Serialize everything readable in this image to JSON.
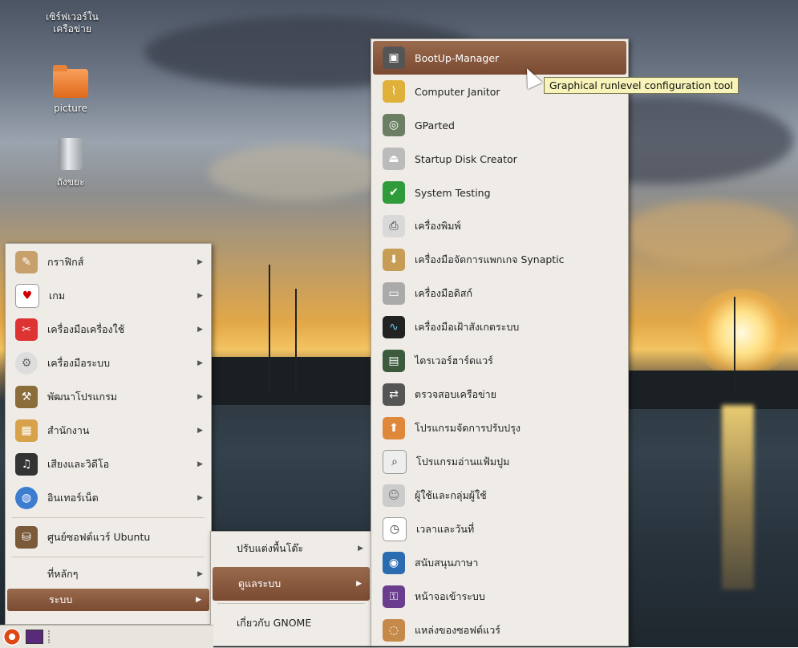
{
  "desktop": {
    "icons": [
      {
        "label": "เซิร์ฟเวอร์ใน\nเครือข่าย",
        "icon": "network-server-icon"
      },
      {
        "label": "picture",
        "icon": "folder-icon"
      },
      {
        "label": "ถังขยะ",
        "icon": "trash-icon"
      }
    ]
  },
  "main_menu": {
    "items": [
      {
        "label": "กราฟิกส์",
        "icon": "graphics-icon",
        "has_sub": true
      },
      {
        "label": "เกม",
        "icon": "games-icon",
        "has_sub": true
      },
      {
        "label": "เครื่องมือเครื่องใช้",
        "icon": "accessories-icon",
        "has_sub": true
      },
      {
        "label": "เครื่องมือระบบ",
        "icon": "system-tools-icon",
        "has_sub": true
      },
      {
        "label": "พัฒนาโปรแกรม",
        "icon": "programming-icon",
        "has_sub": true
      },
      {
        "label": "สำนักงาน",
        "icon": "office-icon",
        "has_sub": true
      },
      {
        "label": "เสียงและวิดีโอ",
        "icon": "sound-video-icon",
        "has_sub": true
      },
      {
        "label": "อินเทอร์เน็ต",
        "icon": "internet-icon",
        "has_sub": true
      },
      {
        "label": "ศูนย์ซอฟต์แวร์ Ubuntu",
        "icon": "ubuntu-software-center-icon",
        "has_sub": false
      }
    ],
    "places_label": "ที่หลักๆ",
    "system_label": "ระบบ"
  },
  "system_menu": {
    "items": [
      {
        "label": "ปรับแต่งพื้นโต๊ะ",
        "has_sub": true
      },
      {
        "label": "ดูแลระบบ",
        "has_sub": true
      },
      {
        "label": "เกี่ยวกับ GNOME",
        "has_sub": false
      }
    ]
  },
  "admin_menu": {
    "items": [
      {
        "label": "BootUp-Manager",
        "icon": "bootup-manager-icon"
      },
      {
        "label": "Computer Janitor",
        "icon": "broom-icon"
      },
      {
        "label": "GParted",
        "icon": "gparted-icon"
      },
      {
        "label": "Startup Disk Creator",
        "icon": "usb-disk-icon"
      },
      {
        "label": "System Testing",
        "icon": "system-testing-icon"
      },
      {
        "label": "เครื่องพิมพ์",
        "icon": "printer-icon"
      },
      {
        "label": "เครื่องมือจัดการแพกเกจ Synaptic",
        "icon": "synaptic-icon"
      },
      {
        "label": "เครื่องมือดิสก์",
        "icon": "disk-utility-icon"
      },
      {
        "label": "เครื่องมือเฝ้าสังเกตระบบ",
        "icon": "system-monitor-icon"
      },
      {
        "label": "ไดรเวอร์ฮาร์ดแวร์",
        "icon": "hardware-drivers-icon"
      },
      {
        "label": "ตรวจสอบเครือข่าย",
        "icon": "network-tools-icon"
      },
      {
        "label": "โปรแกรมจัดการปรับปรุง",
        "icon": "update-manager-icon"
      },
      {
        "label": "โปรแกรมอ่านแฟ้มปูม",
        "icon": "log-viewer-icon"
      },
      {
        "label": "ผู้ใช้และกลุ่มผู้ใช้",
        "icon": "users-groups-icon"
      },
      {
        "label": "เวลาและวันที่",
        "icon": "time-date-icon"
      },
      {
        "label": "สนับสนุนภาษา",
        "icon": "language-support-icon"
      },
      {
        "label": "หน้าจอเข้าระบบ",
        "icon": "login-screen-icon"
      },
      {
        "label": "แหล่งของซอฟต์แวร์",
        "icon": "software-sources-icon"
      }
    ]
  },
  "tooltip": "Graphical runlevel configuration tool",
  "colors": {
    "highlight": "#7a4a32",
    "menu_bg": "#efece8",
    "tooltip_bg": "#f7f3b9"
  }
}
